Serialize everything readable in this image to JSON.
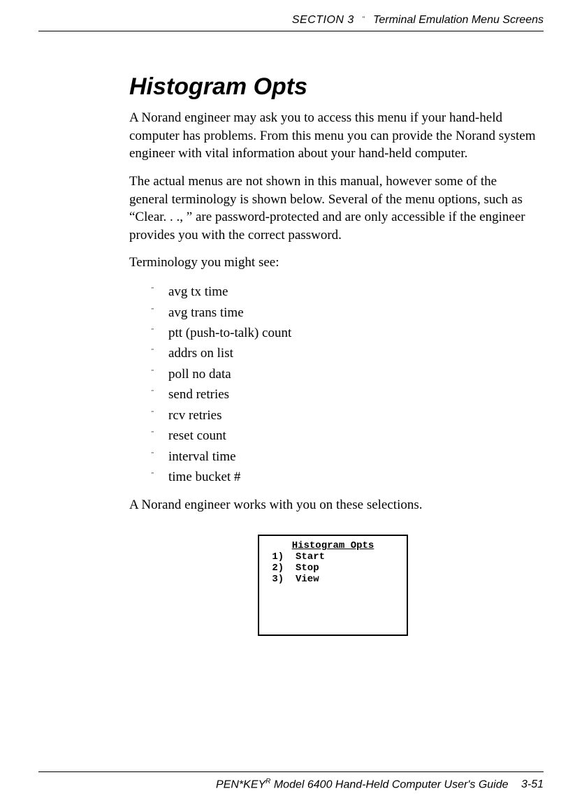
{
  "header": {
    "section_label": "SECTION 3",
    "bullet": "\"",
    "title": "Terminal Emulation Menu Screens"
  },
  "heading": "Histogram Opts",
  "para1": "A Norand engineer may ask you to access this menu if your hand-held computer has problems.  From this menu you can provide the Norand system engineer with vital informa­tion about your hand-held computer.",
  "para2": "The actual menus are not shown in this manual, however some of the general terminology is shown below.  Several of the menu options, such as “Clear. . ., ” are password-pro­tected and are only accessible if the engineer provides you with the correct password.",
  "para3": "Terminology you might see:",
  "terms": [
    "avg tx time",
    "avg trans time",
    "ptt (push-to-talk) count",
    "addrs on list",
    "poll no data",
    "send retries",
    "rcv retries",
    "reset count",
    "interval time",
    "time bucket #"
  ],
  "para4": "A Norand engineer works with you on these selections.",
  "menu": {
    "title": "Histogram Opts",
    "items": [
      " 1)  Start",
      " 2)  Stop",
      " 3)  View"
    ]
  },
  "footer": {
    "product_prefix": "PEN*KEY",
    "super": "R",
    "product_rest": "  Model 6400 Hand-Held Computer User's Guide",
    "page": "3-51"
  }
}
